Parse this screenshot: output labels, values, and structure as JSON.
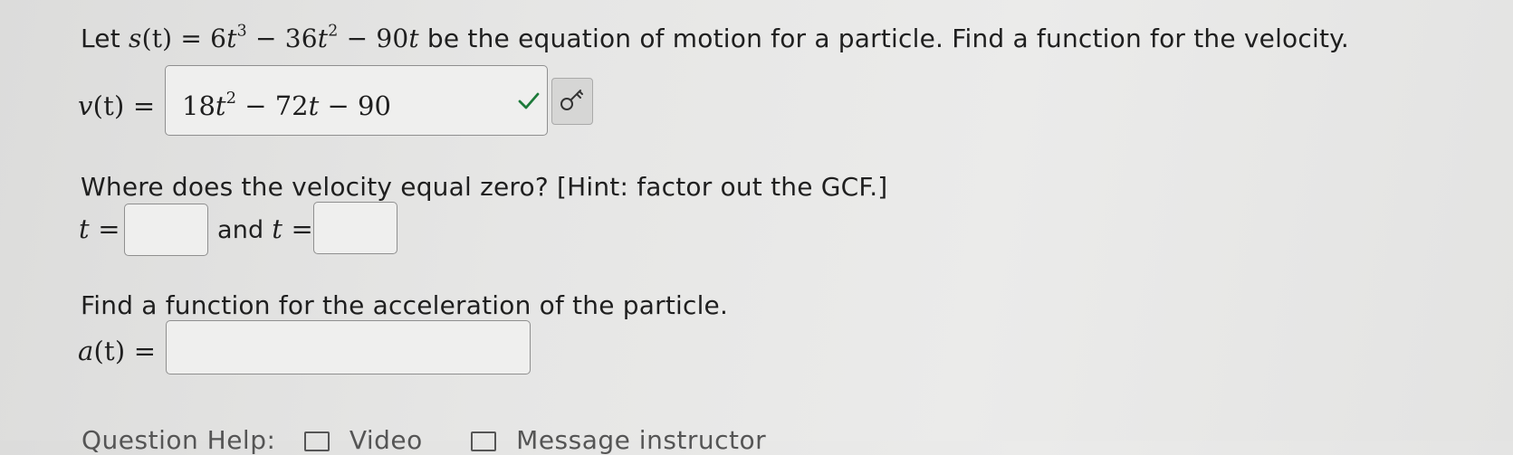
{
  "question1": {
    "prefix": "Let ",
    "s_label": "s",
    "s_arg": "(t)",
    "equals": " = ",
    "term1_coef": "6",
    "term1_var": "t",
    "term1_exp": "3",
    "minus1": " − 36",
    "term2_var": "t",
    "term2_exp": "2",
    "minus2": " − 90",
    "term3_var": "t",
    "suffix": " be the equation of motion for a particle. Find a function for the velocity."
  },
  "velocity": {
    "label_fn": "v",
    "label_arg": "(t)",
    "label_eq": " =",
    "answer_coef": "18",
    "answer_var1": "t",
    "answer_exp": "2",
    "answer_mid": " − 72",
    "answer_var2": "t",
    "answer_tail": " − 90",
    "status": "correct"
  },
  "question2": {
    "text": "Where does the velocity equal zero? [Hint: factor out the GCF.]",
    "t_label": "t",
    "t_eq": " =",
    "and_text": "and ",
    "t2_label": "t",
    "t2_eq": " =",
    "answer1_value": "",
    "answer2_value": ""
  },
  "question3": {
    "text": "Find a function for the acceleration of the particle.",
    "label_fn": "a",
    "label_arg": "(t)",
    "label_eq": " =",
    "answer_value": ""
  },
  "colors": {
    "check_green": "#1d7a3a",
    "text": "#1f1f1f",
    "border": "#8f8f8f"
  },
  "icons": {
    "check": "check-icon",
    "key": "key-icon",
    "video": "video-icon",
    "message": "message-icon"
  },
  "footer": {
    "help_label": "Question Help:",
    "video_label": "Video",
    "message_label": "Message instructor"
  }
}
